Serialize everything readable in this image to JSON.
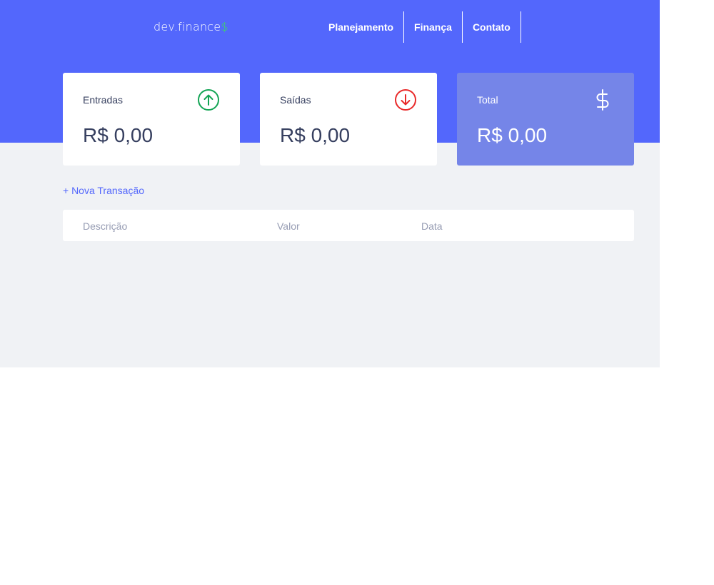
{
  "logo": {
    "part1": "dev",
    "dot": ".",
    "part2": "finance",
    "accent": "$"
  },
  "nav": {
    "items": [
      "Planejamento",
      "Finança",
      "Contato"
    ]
  },
  "cards": {
    "income": {
      "label": "Entradas",
      "value": "R$ 0,00",
      "icon": "arrow-up-circle-icon",
      "icon_color": "#12a454"
    },
    "expense": {
      "label": "Saídas",
      "value": "R$ 0,00",
      "icon": "arrow-down-circle-icon",
      "icon_color": "#e92929"
    },
    "total": {
      "label": "Total",
      "value": "R$ 0,00",
      "icon": "dollar-icon"
    }
  },
  "actions": {
    "new_transaction": "+ Nova Transação"
  },
  "table": {
    "headers": [
      "Descrição",
      "Valor",
      "Data"
    ]
  },
  "colors": {
    "primary": "#5367fc",
    "total_card": "#7585e8",
    "background": "#f0f2f5",
    "text": "#363f5f"
  }
}
